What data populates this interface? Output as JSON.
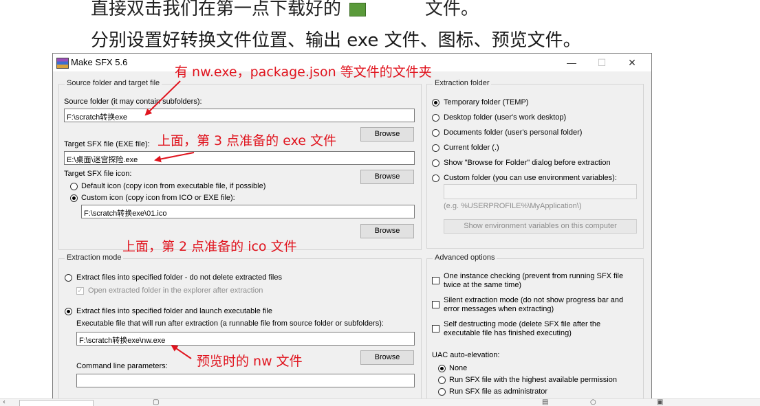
{
  "document": {
    "line1_before": "直接双击我们在第一点下载好的",
    "line1_after": "文件。",
    "line2": "分别设置好转换文件位置、输出 exe 文件、图标、预览文件。"
  },
  "window": {
    "title": "Make SFX 5.6",
    "minimize": "—",
    "maximize": "☐",
    "close": "✕"
  },
  "source_group": {
    "title": "Source folder and target file",
    "source_label": "Source folder (it may contain subfolders):",
    "source_value": "F:\\scratch转换exe",
    "browse": "Browse",
    "target_label": "Target SFX file (EXE file):",
    "target_value": "E:\\桌面\\迷宫探险.exe",
    "icon_label": "Target SFX file icon:",
    "default_icon": "Default icon (copy icon from executable file, if possible)",
    "custom_icon": "Custom icon (copy icon from ICO or EXE file):",
    "icon_value": "F:\\scratch转换exe\\01.ico"
  },
  "extraction_mode": {
    "title": "Extraction mode",
    "opt_nodelete": "Extract files into specified folder - do not delete extracted files",
    "open_in_explorer": "Open extracted folder in the explorer after extraction",
    "opt_launch": "Extract files into specified folder and launch executable file",
    "exec_label": "Executable file that will run after extraction (a runnable file from source folder or subfolders):",
    "exec_value": "F:\\scratch转换exe\\nw.exe",
    "browse": "Browse",
    "cmd_label": "Command line parameters:",
    "cmd_value": ""
  },
  "extraction_folder": {
    "title": "Extraction folder",
    "options": [
      "Temporary folder (TEMP)",
      "Desktop folder (user's work desktop)",
      "Documents folder (user's personal folder)",
      "Current folder (.)",
      "Show \"Browse for Folder\" dialog before extraction",
      "Custom folder (you can use environment variables):"
    ],
    "selected_index": 0,
    "custom_value": "",
    "example": "(e.g. %USERPROFILE%\\MyApplication\\)",
    "env_button": "Show environment variables on this computer"
  },
  "advanced": {
    "title": "Advanced options",
    "one_instance_1": "One instance checking (prevent from running SFX file",
    "one_instance_2": "twice at the same time)",
    "silent_1": "Silent extraction mode (do not show progress bar and",
    "silent_2": "error messages when extracting)",
    "selfdestruct_1": "Self destructing mode (delete SFX file after the",
    "selfdestruct_2": "executable file has finished executing)",
    "uac_label": "UAC auto-elevation:",
    "uac_none": "None",
    "uac_highest": "Run SFX file with the highest available permission",
    "uac_admin": "Run SFX file as administrator"
  },
  "annotations": {
    "folder_note": "有 nw.exe，package.json 等文件的文件夹",
    "exe_note": "上面，第 3 点准备的 exe 文件",
    "ico_note": "上面，第 2 点准备的 ico 文件",
    "preview_note": "预览时的 nw 文件",
    "color": "#e0141e"
  }
}
